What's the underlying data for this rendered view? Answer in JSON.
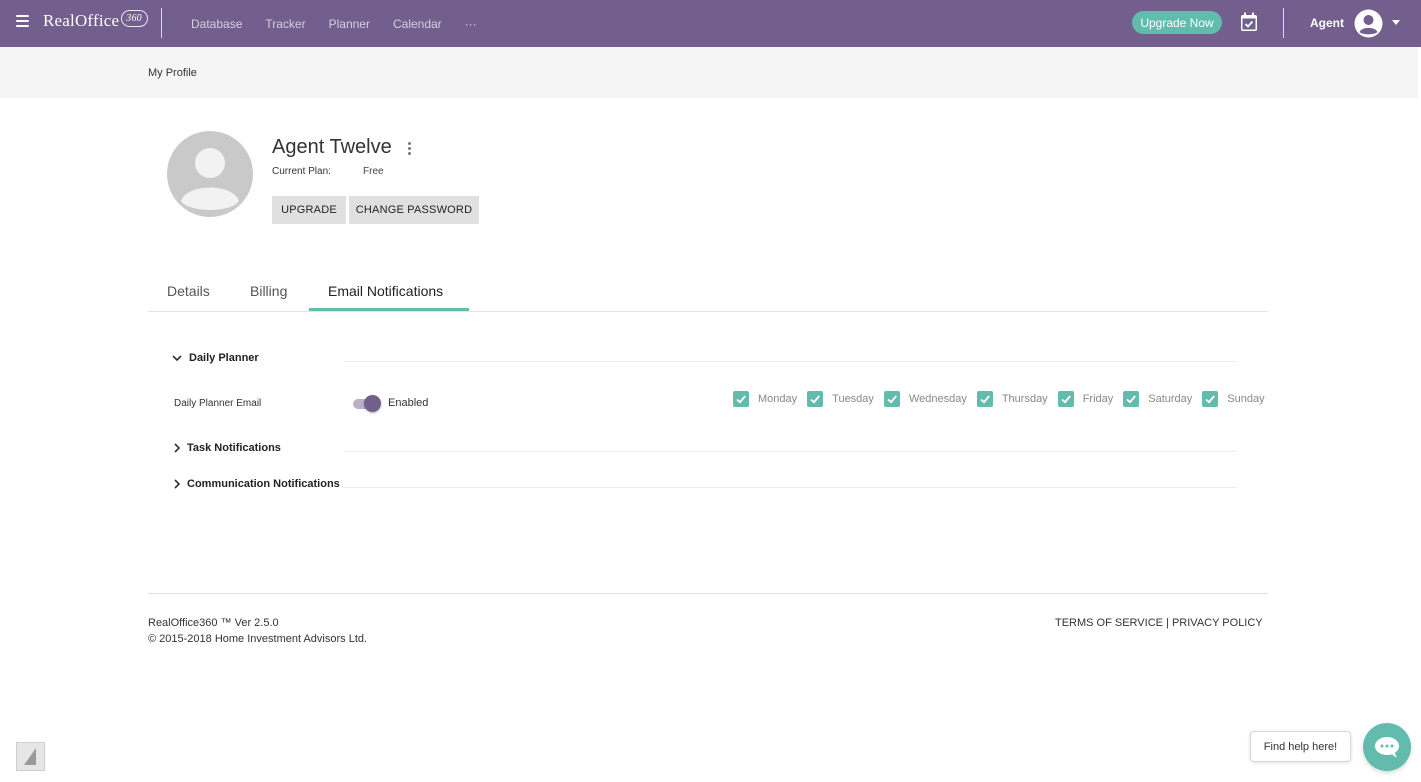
{
  "app": {
    "logo_text": "RealOffice",
    "logo_suffix": "360"
  },
  "nav": {
    "items": [
      "Database",
      "Tracker",
      "Planner",
      "Calendar",
      "···"
    ]
  },
  "topbar": {
    "upgrade_label": "Upgrade Now",
    "user_label": "Agent",
    "icons": [
      "menu-icon",
      "calendar-check-icon",
      "account-circle-icon",
      "caret-down-icon"
    ]
  },
  "breadcrumb": {
    "current": "My Profile"
  },
  "profile": {
    "name": "Agent Twelve",
    "plan_label": "Current Plan:",
    "plan_value": "Free",
    "upgrade_button": "UPGRADE",
    "change_password_button": "CHANGE PASSWORD"
  },
  "tabs": [
    {
      "label": "Details",
      "active": false
    },
    {
      "label": "Billing",
      "active": false
    },
    {
      "label": "Email Notifications",
      "active": true
    }
  ],
  "sections": {
    "daily_planner": {
      "title": "Daily Planner",
      "expanded": true,
      "row_label": "Daily Planner Email",
      "toggle_on": true,
      "toggle_text": "Enabled",
      "days": [
        {
          "label": "Monday",
          "checked": true
        },
        {
          "label": "Tuesday",
          "checked": true
        },
        {
          "label": "Wednesday",
          "checked": true
        },
        {
          "label": "Thursday",
          "checked": true
        },
        {
          "label": "Friday",
          "checked": true
        },
        {
          "label": "Saturday",
          "checked": true
        },
        {
          "label": "Sunday",
          "checked": true
        }
      ]
    },
    "task_notifications": {
      "title": "Task Notifications",
      "expanded": false
    },
    "communication_notifications": {
      "title": "Communication Notifications",
      "expanded": false
    }
  },
  "footer": {
    "version": "RealOffice360 ™ Ver 2.5.0",
    "copyright": "© 2015-2018 Home Investment Advisors Ltd.",
    "terms": "TERMS OF SERVICE",
    "separator": " | ",
    "privacy": "PRIVACY POLICY"
  },
  "help": {
    "bubble_text": "Find help here!"
  },
  "colors": {
    "brand_purple": "#735f8d",
    "accent_teal": "#62bcae",
    "background": "#ffffff",
    "band_gray": "#f5f5f5"
  }
}
